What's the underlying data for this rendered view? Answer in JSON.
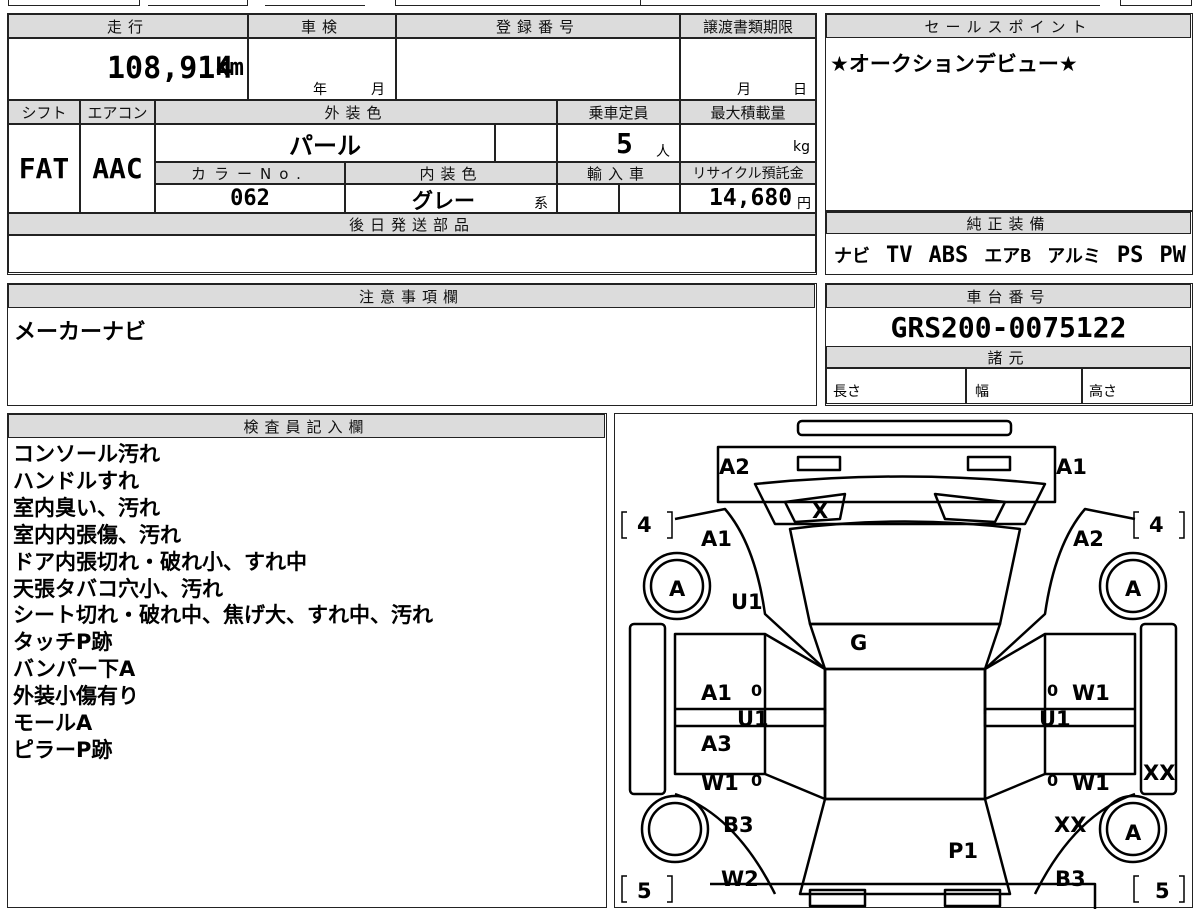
{
  "main_table": {
    "mileage_header": "走行",
    "mileage_value": "108,914",
    "mileage_unit": "km",
    "inspection_header": "車検",
    "inspection_year": "年",
    "inspection_month": "月",
    "registration_header": "登録番号",
    "transfer_header": "譲渡書類期限",
    "transfer_month": "月",
    "transfer_day": "日",
    "shift_header": "シフト",
    "ac_header": "エアコン",
    "exterior_color_header": "外装色",
    "capacity_header": "乗車定員",
    "max_load_header": "最大積載量",
    "shift_value": "FAT",
    "ac_value": "AAC",
    "exterior_color_value": "パール",
    "capacity_value": "5",
    "capacity_unit": "人",
    "max_load_unit": "kg",
    "color_no_header": "カラーNo.",
    "interior_color_header": "内装色",
    "import_header": "輸入車",
    "recycle_header": "リサイクル預託金",
    "color_no_value": "062",
    "interior_color_value": "グレー",
    "interior_color_suffix": "系",
    "recycle_value": "14,680",
    "recycle_unit": "円",
    "later_parts_header": "後日発送部品"
  },
  "sales_point": {
    "header": "セールスポイント",
    "text": "★オークションデビュー★"
  },
  "genuine_equipment": {
    "header": "純正装備",
    "items": [
      "ナビ",
      "TV",
      "ABS",
      "エアB",
      "アルミ",
      "PS",
      "PW"
    ]
  },
  "notes": {
    "header": "注意事項欄",
    "text": "メーカーナビ"
  },
  "chassis": {
    "header": "車台番号",
    "number": "GRS200-0075122",
    "specs_header": "諸元",
    "length": "長さ",
    "width": "幅",
    "height": "高さ"
  },
  "inspector": {
    "header": "検査員記入欄",
    "lines": [
      "コンソール汚れ",
      "ハンドルすれ",
      "室内臭い、汚れ",
      "室内内張傷、汚れ",
      "ドア内張切れ・破れ小、すれ中",
      "天張タバコ穴小、汚れ",
      "シート切れ・破れ中、焦げ大、すれ中、汚れ",
      "タッチP跡",
      "バンパー下A",
      "外装小傷有り",
      "モールA",
      "ピラーP跡"
    ]
  },
  "diagram": {
    "marks": {
      "front_left_bumper": "A2",
      "front_right_bumper": "A1",
      "windshield": "X",
      "bracket_left_top": "4",
      "bracket_right_top": "4",
      "left_front_fender": "A1",
      "right_front_fender": "A2",
      "left_front_wheel": "A",
      "right_front_wheel": "A",
      "left_fender_u": "U1",
      "roof": "G",
      "left_front_door": "A1",
      "left_front_door_zero": "0",
      "left_door_u": "U1",
      "right_front_door_zero": "0",
      "right_front_door": "W1",
      "right_door_u": "U1",
      "left_rear_door": "A3",
      "left_rear_door_w": "W1",
      "left_rear_door_zero": "0",
      "right_rear_door_zero": "0",
      "right_rear_door": "W1",
      "right_side_xx": "XX",
      "left_rear_quarter": "B3",
      "right_rear_quarter": "XX",
      "right_rear_wheel": "A",
      "trunk": "P1",
      "left_rear_bottom": "W2",
      "right_rear_bottom": "B3",
      "bracket_left_bottom": "5",
      "bracket_right_bottom": "5"
    }
  }
}
